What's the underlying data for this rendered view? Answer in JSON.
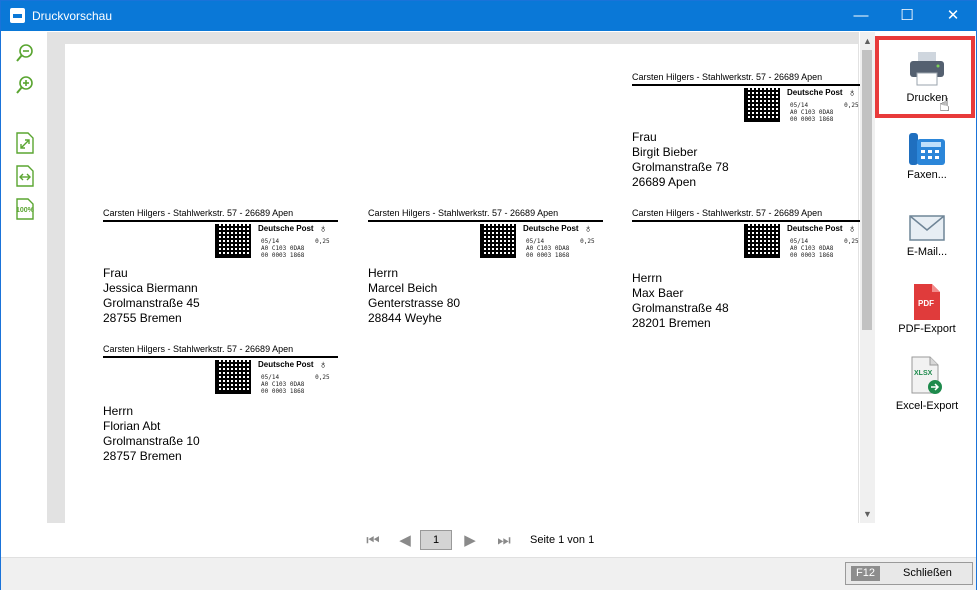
{
  "window": {
    "title": "Druckvorschau",
    "minimize": "—",
    "maximize": "☐",
    "close": "✕"
  },
  "toolbar_left": [
    {
      "name": "zoom-out-icon"
    },
    {
      "name": "zoom-in-icon"
    },
    {
      "name": "fit-page-icon"
    },
    {
      "name": "fit-width-icon"
    },
    {
      "name": "zoom-100-icon",
      "text": "100%"
    }
  ],
  "labels": [
    {
      "sender": "Carsten Hilgers - Stahlwerkstr. 57 - 26689 Apen",
      "brand": "Deutsche Post",
      "codes": "05/14          0,25\nA0 C103 0DA8\n00 0003 1868",
      "salutation": "Frau",
      "name": "Birgit Bieber",
      "street": "Grolmanstraße 78",
      "city": "26689 Apen"
    },
    {
      "sender": "Carsten Hilgers - Stahlwerkstr. 57 - 26689 Apen",
      "brand": "Deutsche Post",
      "codes": "05/14          0,25\nA0 C103 0DA8\n00 0003 1868",
      "salutation": "Frau",
      "name": "Jessica Biermann",
      "street": "Grolmanstraße 45",
      "city": "28755 Bremen"
    },
    {
      "sender": "Carsten Hilgers - Stahlwerkstr. 57 - 26689 Apen",
      "brand": "Deutsche Post",
      "codes": "05/14          0,25\nA0 C103 0DA8\n00 0003 1868",
      "salutation": "Herrn",
      "name": "Marcel Beich",
      "street": "Genterstrasse 80",
      "city": "28844 Weyhe"
    },
    {
      "sender": "Carsten Hilgers - Stahlwerkstr. 57 - 26689 Apen",
      "brand": "Deutsche Post",
      "codes": "05/14          0,25\nA0 C103 0DA8\n00 0003 1868",
      "salutation": "Herrn",
      "name": "Max Baer",
      "street": "Grolmanstraße 48",
      "city": "28201 Bremen"
    },
    {
      "sender": "Carsten Hilgers - Stahlwerkstr. 57 - 26689 Apen",
      "brand": "Deutsche Post",
      "codes": "05/14          0,25\nA0 C103 0DA8\n00 0003 1868",
      "salutation": "Herrn",
      "name": "Florian Abt",
      "street": "Grolmanstraße 10",
      "city": "28757 Bremen"
    }
  ],
  "pager": {
    "current_page": "1",
    "info": "Seite 1 von 1"
  },
  "actions": [
    {
      "name": "print",
      "label": "Drucken"
    },
    {
      "name": "fax",
      "label": "Faxen..."
    },
    {
      "name": "email",
      "label": "E-Mail..."
    },
    {
      "name": "pdf",
      "label": "PDF-Export",
      "icon_text": "PDF"
    },
    {
      "name": "excel",
      "label": "Excel-Export",
      "icon_text": "XLSX"
    }
  ],
  "footer": {
    "key": "F12",
    "close_label": "Schließen"
  },
  "colors": {
    "titlebar": "#0a78d7",
    "accent_green": "#5aa531",
    "highlight": "#e83a3a",
    "pdf_red": "#e03b3b",
    "print_gray": "#546070",
    "fax_blue": "#1f6fbf"
  }
}
